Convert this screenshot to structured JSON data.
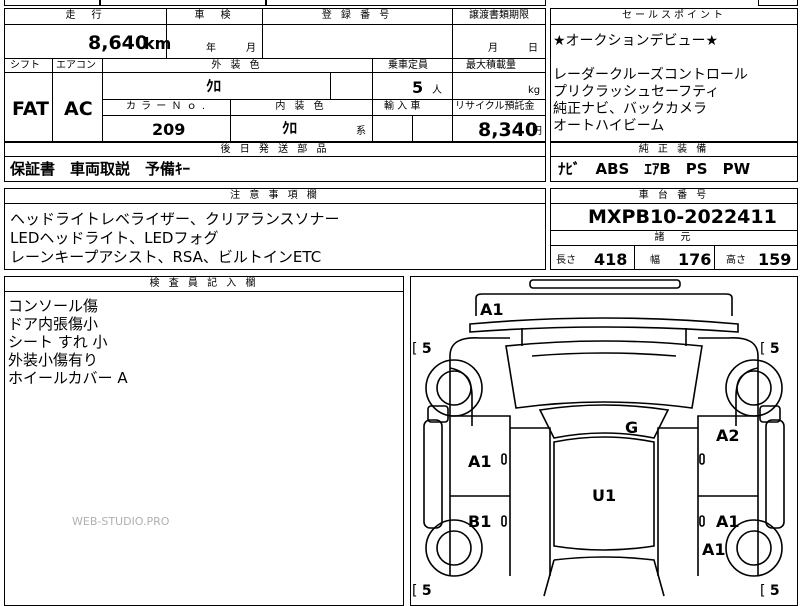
{
  "top_strip": {
    "cell1_partial": "",
    "cell2_partial": "",
    "cell3_partial": ""
  },
  "mileage": {
    "header": "走　行",
    "value": "8,640",
    "unit": "km"
  },
  "inspection": {
    "header": "車　検",
    "year_unit": "年",
    "month_unit": "月"
  },
  "registration": {
    "header": "登 録 番 号",
    "value": ""
  },
  "transfer_deadline": {
    "header": "譲渡書類期限",
    "month_unit": "月",
    "day_unit": "日"
  },
  "selling_points": {
    "header": "セールスポイント",
    "lines": [
      "★オークションデビュー★",
      "",
      "レーダークルーズコントロール",
      "プリクラッシュセーフティ",
      "純正ナビ、バックカメラ",
      "オートハイビーム"
    ]
  },
  "shift": {
    "header": "シフト",
    "value": "FAT"
  },
  "aircon": {
    "header": "エアコン",
    "value": "AC"
  },
  "exterior_color": {
    "header": "外 装 色",
    "value": "ｸﾛ"
  },
  "capacity": {
    "header": "乗車定員",
    "value": "5",
    "unit": "人"
  },
  "max_load": {
    "header": "最大積載量",
    "unit": "kg"
  },
  "color_no": {
    "header": "カ ラ ー Ｎ ｏ .",
    "value": "209"
  },
  "interior_color": {
    "header": "内 装 色",
    "value": "ｸﾛ",
    "unit": "系"
  },
  "import": {
    "header": "輸 入 車"
  },
  "recycle": {
    "header": "リサイクル預託金",
    "value": "8,340",
    "unit": "円"
  },
  "later_parts": {
    "header": "後 日 発 送 部 品",
    "value": "保証書　車両取説　予備ｷｰ"
  },
  "factory_equipment": {
    "header": "純 正 装 備",
    "value": "ﾅﾋﾞ　ABS　ｴｱB　PS　PW"
  },
  "notes": {
    "header": "注 意 事 項 欄",
    "lines": [
      "ヘッドライトレベライザー、クリアランスソナー",
      "LEDヘッドライト、LEDフォグ",
      "レーンキープアシスト、RSA、ビルトインETC"
    ]
  },
  "chassis": {
    "header": "車 台 番 号",
    "value": "MXPB10-2022411"
  },
  "specs": {
    "header": "諸　元",
    "length_label": "長さ",
    "length": "418",
    "width_label": "幅",
    "width": "176",
    "height_label": "高さ",
    "height": "159"
  },
  "inspector": {
    "header": "検 査 員 記 入 欄",
    "lines": [
      "コンソール傷",
      "ドア内張傷小",
      "シート すれ 小",
      "外装小傷有り",
      "ホイールカバー A"
    ]
  },
  "watermark": "WEB-STUDIO.PRO",
  "diagram": {
    "marks": {
      "front_bumper": "A1",
      "roof": "G",
      "cabin": "U1",
      "left_front_door": "A1",
      "left_rear_door": "B1",
      "right_front_door": "A2",
      "right_rear_door": "A1",
      "right_rear_quarter": "A1"
    },
    "tyre_labels": {
      "front_left": "5",
      "front_right": "5",
      "rear_left": "5",
      "rear_right": "5"
    }
  }
}
